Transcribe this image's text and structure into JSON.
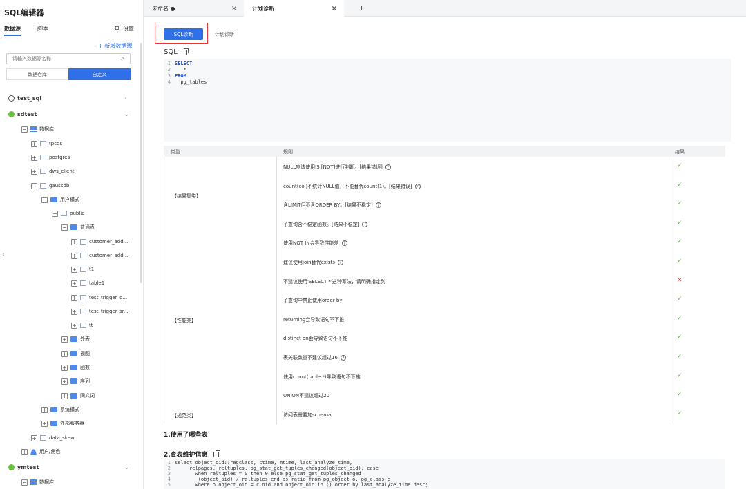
{
  "sidebar": {
    "title": "SQL编辑器",
    "tabs": [
      "数据源",
      "脚本"
    ],
    "settings_label": "设置",
    "add_label": "+ 新增数据源",
    "search_placeholder": "请输入数据源名称",
    "segments": [
      "数据仓库",
      "自定义"
    ],
    "tree": [
      {
        "label": "test_sql",
        "kind": "top-globe",
        "chev": ">"
      },
      {
        "label": "sdtest",
        "kind": "top-green",
        "chev": "v"
      },
      {
        "label": "数据库",
        "kind": "grid"
      },
      {
        "label": "tpcds",
        "kind": "db"
      },
      {
        "label": "postgres",
        "kind": "db"
      },
      {
        "label": "dws_client",
        "kind": "db"
      },
      {
        "label": "gaussdb",
        "kind": "db"
      },
      {
        "label": "用户模式",
        "kind": "folder"
      },
      {
        "label": "public",
        "kind": "db"
      },
      {
        "label": "普通表",
        "kind": "folder"
      },
      {
        "label": "customer_add...",
        "kind": "table"
      },
      {
        "label": "customer_add...",
        "kind": "table"
      },
      {
        "label": "t1",
        "kind": "table"
      },
      {
        "label": "table1",
        "kind": "table"
      },
      {
        "label": "test_trigger_d...",
        "kind": "table"
      },
      {
        "label": "test_trigger_sr...",
        "kind": "table"
      },
      {
        "label": "tt",
        "kind": "table"
      },
      {
        "label": "外表",
        "kind": "folder"
      },
      {
        "label": "视图",
        "kind": "folder"
      },
      {
        "label": "函数",
        "kind": "folder"
      },
      {
        "label": "序列",
        "kind": "folder"
      },
      {
        "label": "同义词",
        "kind": "folder"
      },
      {
        "label": "系统模式",
        "kind": "folder"
      },
      {
        "label": "外部服务器",
        "kind": "folder"
      },
      {
        "label": "data_skew",
        "kind": "db"
      },
      {
        "label": "用户/角色",
        "kind": "user"
      },
      {
        "label": "ymtest",
        "kind": "top-green",
        "chev": "v"
      },
      {
        "label": "数据库",
        "kind": "grid"
      }
    ]
  },
  "tabs": [
    {
      "label": "未命名 ●"
    },
    {
      "label": "计划诊断"
    }
  ],
  "tab_add": "+",
  "tab_close": "×",
  "mode": {
    "sql_label": "SQL诊断",
    "plan_label": "计划诊断"
  },
  "sql_section": {
    "title": "SQL",
    "lines": [
      {
        "n": "1",
        "text": "SELECT",
        "kw": true
      },
      {
        "n": "2",
        "text": "   *",
        "kw": false
      },
      {
        "n": "3",
        "text": "FROM",
        "kw": true
      },
      {
        "n": "4",
        "text": "  pg_tables",
        "kw": false
      }
    ]
  },
  "results": {
    "headers": {
      "type": "类型",
      "rule": "规则",
      "result": "结果"
    },
    "categories": [
      "【结果集类】",
      "【性能类】",
      "【规范类】"
    ],
    "rows": [
      {
        "rule": "NULL应该使用IS [NOT]进行判断。[结果错误]",
        "help": true,
        "ok": true
      },
      {
        "rule": "count(col)不统计NULL值，不能替代count(1)。[结果错误]",
        "help": true,
        "ok": true
      },
      {
        "rule": "含LIMIT但不含ORDER BY。[结果不稳定]",
        "help": true,
        "ok": true
      },
      {
        "rule": "子查询含不稳定函数。[结果不稳定]",
        "help": true,
        "ok": true
      },
      {
        "rule": "使用NOT IN会导致性能差",
        "help": true,
        "ok": true
      },
      {
        "rule": "建议使用join替代exists",
        "help": true,
        "ok": true
      },
      {
        "rule": "不建议使用'SELECT *'这种写法，请明确指定列",
        "help": false,
        "ok": false
      },
      {
        "rule": "子查询中禁止使用order by",
        "help": false,
        "ok": true
      },
      {
        "rule": "returning会导致语句不下推",
        "help": false,
        "ok": true
      },
      {
        "rule": "distinct on会导致语句不下推",
        "help": false,
        "ok": true
      },
      {
        "rule": "表关联数量不建议超过16",
        "help": true,
        "ok": true
      },
      {
        "rule": "使用count(table.*)导致语句不下推",
        "help": false,
        "ok": true
      },
      {
        "rule": "UNION不建议超过20",
        "help": false,
        "ok": true
      },
      {
        "rule": "访问表需要加schema",
        "help": false,
        "ok": true
      }
    ],
    "ok_glyph": "✓",
    "bad_glyph": "✕"
  },
  "section1": {
    "title": "1.使用了哪些表"
  },
  "section2": {
    "title": "2.查表维护信息",
    "lines": [
      {
        "n": "1",
        "text": "select object_oid::regclass, ctime, mtime, last_analyze_time,"
      },
      {
        "n": "2",
        "text": "     relpages, reltuples, pg_stat_get_tuples_changed(object_oid), case"
      },
      {
        "n": "3",
        "text": "       when reltuples = 0 then 0 else pg_stat_get_tuples_changed"
      },
      {
        "n": "4",
        "text": "        (object_oid) / reltuples end as ratio from pg_object o, pg_class c"
      },
      {
        "n": "5",
        "text": "       where o.object_oid = c.oid and object_oid in () order by last_analyze_time desc;"
      }
    ]
  },
  "colors": {
    "accent": "#2f6fe8",
    "ok": "#5aa832",
    "bad": "#e33333",
    "highlight_border": "#e33333"
  }
}
